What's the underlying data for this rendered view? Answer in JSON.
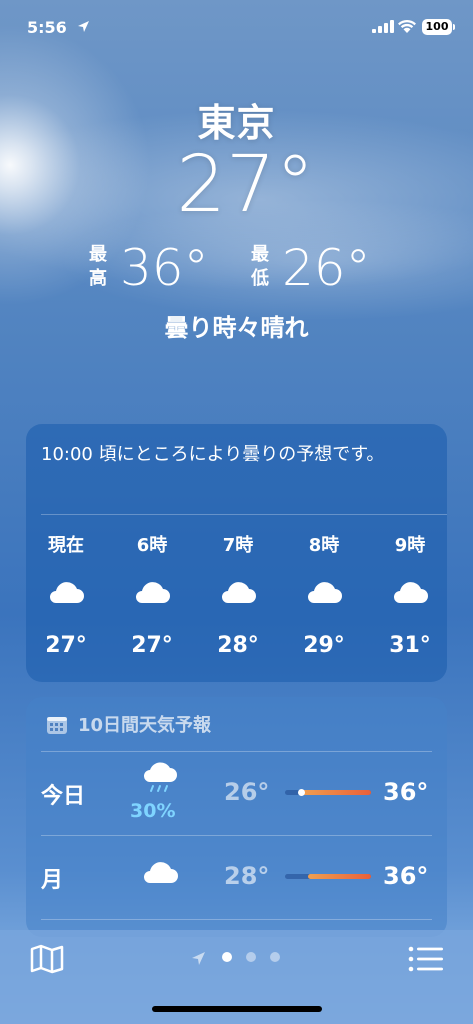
{
  "status_bar": {
    "time": "5:56",
    "battery": "100"
  },
  "header": {
    "city": "東京",
    "temperature": "27°",
    "high_label_top": "最",
    "high_label_bottom": "高",
    "high_value": "36°",
    "low_label_top": "最",
    "low_label_bottom": "低",
    "low_value": "26°",
    "condition": "曇り時々晴れ"
  },
  "hourly": {
    "summary": "10:00 頃にところにより曇りの予想です。",
    "items": [
      {
        "label": "現在",
        "icon": "cloud-icon",
        "temp": "27°"
      },
      {
        "label": "6時",
        "icon": "cloud-icon",
        "temp": "27°"
      },
      {
        "label": "7時",
        "icon": "cloud-icon",
        "temp": "28°"
      },
      {
        "label": "8時",
        "icon": "cloud-icon",
        "temp": "29°"
      },
      {
        "label": "9時",
        "icon": "cloud-icon",
        "temp": "31°"
      }
    ]
  },
  "daily": {
    "title": "10日間天気予報",
    "icon": "calendar-icon",
    "rows": [
      {
        "day": "今日",
        "icon": "cloud-rain-icon",
        "precip": "30%",
        "low": "26°",
        "high": "36°",
        "range_start": 0.18,
        "range_end": 1.0,
        "current": 0.18
      },
      {
        "day": "月",
        "icon": "cloud-icon",
        "precip": "",
        "low": "28°",
        "high": "36°",
        "range_start": 0.27,
        "range_end": 1.0
      }
    ]
  },
  "bottom_bar": {
    "map_icon": "map-icon",
    "location_icon": "location-arrow-icon",
    "list_icon": "list-icon",
    "pages": 3,
    "active_page": 1
  }
}
